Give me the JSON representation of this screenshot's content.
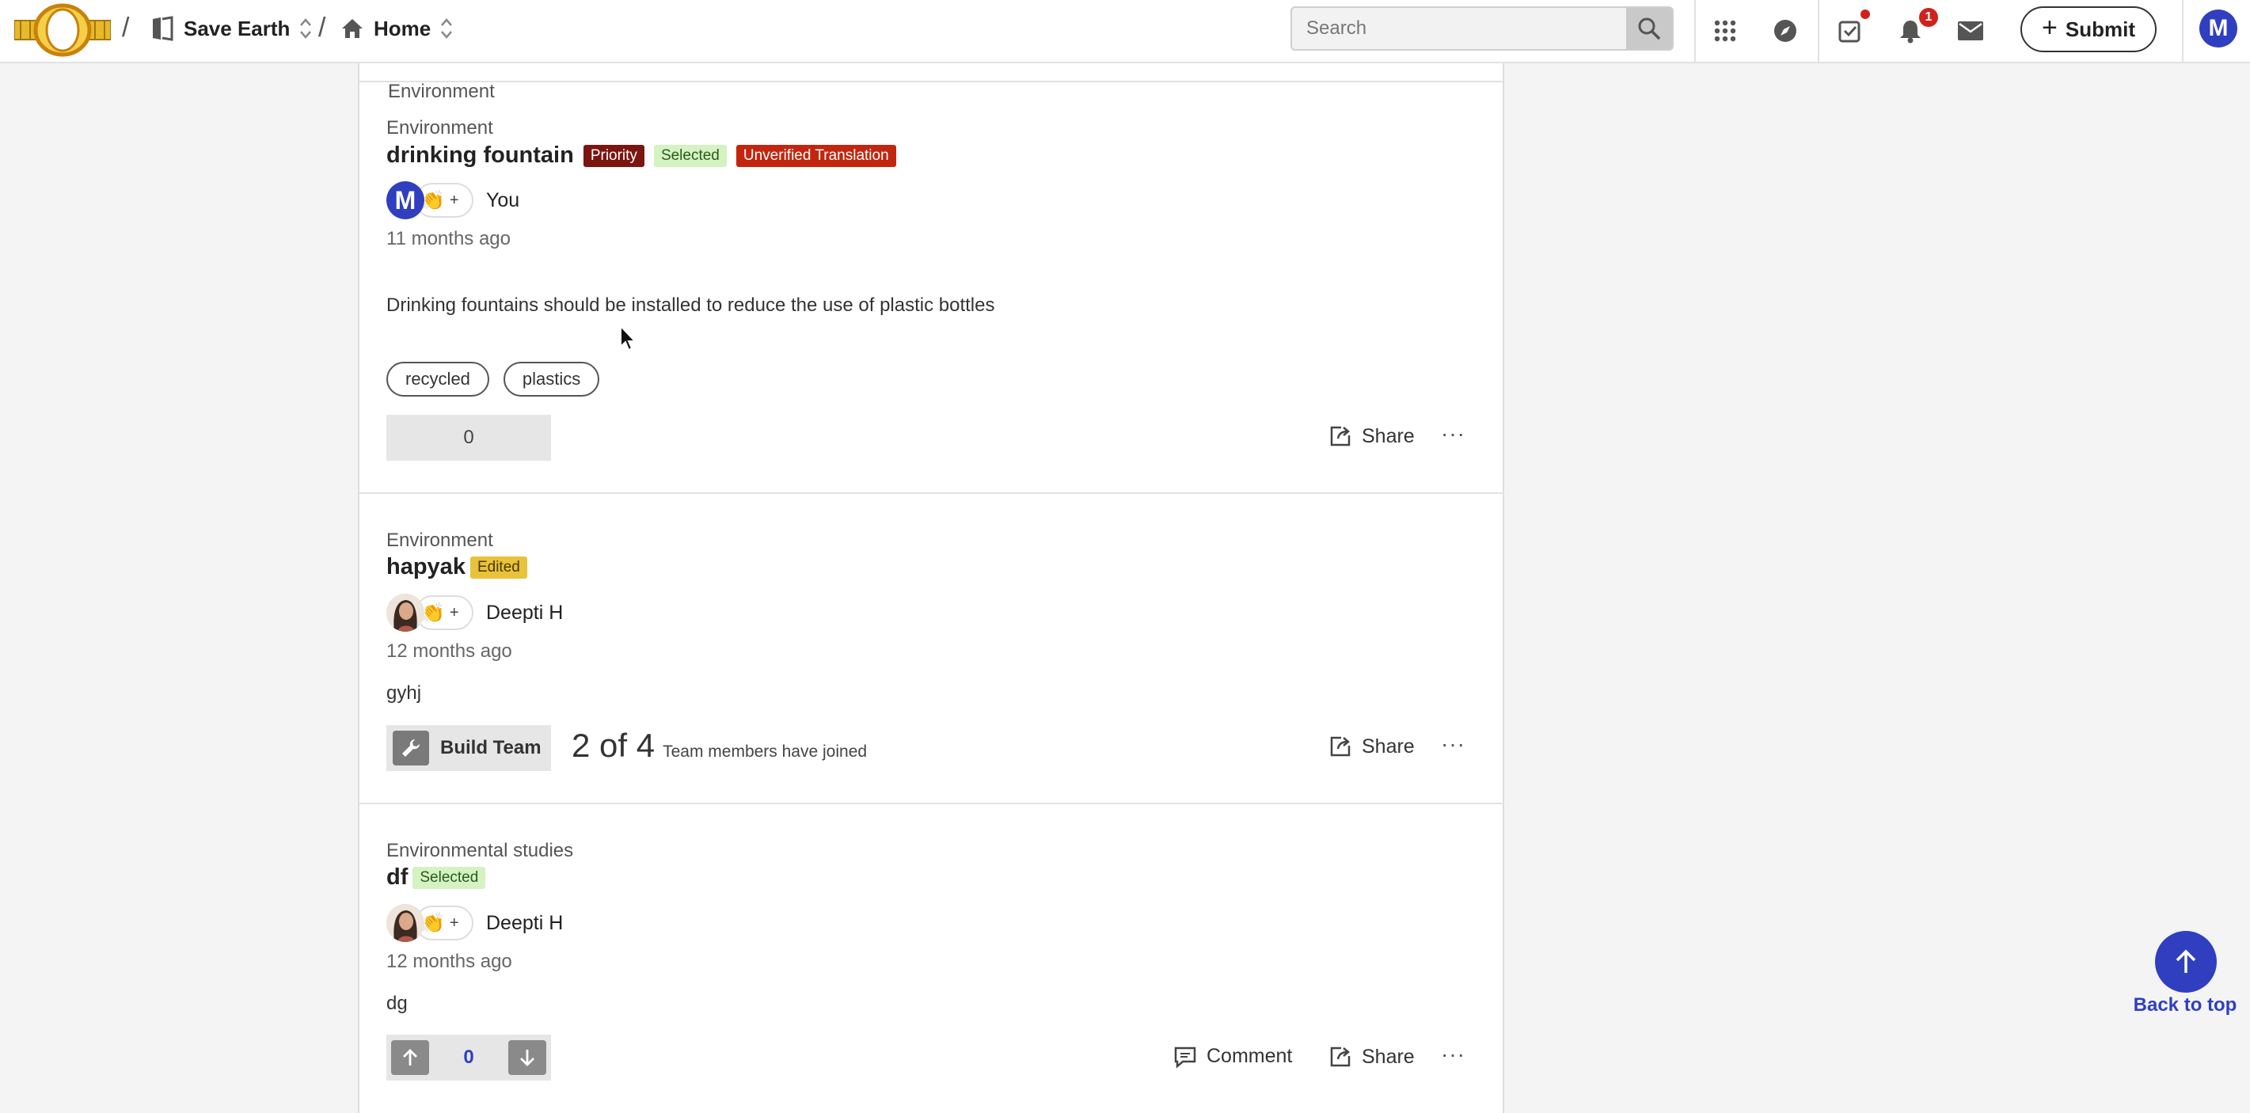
{
  "header": {
    "workspace": "Save Earth",
    "page": "Home",
    "search_placeholder": "Search",
    "notification_count": "1",
    "submit_label": "Submit",
    "user_initial": "M",
    "icons": [
      "apps-grid-icon",
      "compass-icon",
      "tasks-check-icon",
      "bell-icon",
      "mail-icon",
      "search-icon"
    ]
  },
  "posts": [
    {
      "category": "Environment",
      "title": "drinking fountain",
      "badges": [
        "Priority",
        "Selected",
        "Unverified Translation"
      ],
      "author_initial": "M",
      "author": "You",
      "time": "11 months ago",
      "body": "Drinking fountains should be installed to reduce the use of plastic bottles",
      "tags": [
        "recycled",
        "plastics"
      ],
      "votes": "0",
      "share": "Share",
      "more": "···"
    },
    {
      "category": "Environment",
      "title": "hapyak",
      "badges": [
        "Edited"
      ],
      "author": "Deepti H",
      "time": "12 months ago",
      "body": "gyhj",
      "build_team_label": "Build Team",
      "team_count": "2 of 4",
      "team_text": "Team members have joined",
      "share": "Share",
      "more": "···"
    },
    {
      "category": "Environmental studies",
      "title": "df",
      "badges": [
        "Selected"
      ],
      "author": "Deepti H",
      "time": "12 months ago",
      "body": "dg",
      "votes": "0",
      "comment": "Comment",
      "share": "Share",
      "more": "···"
    }
  ],
  "back_to_top": "Back to top",
  "reaction_emoji": "👏",
  "reaction_plus": "+",
  "colors": {
    "brand_blue": "#2f3fbf",
    "priority": "#7a1510",
    "selected_bg": "#d4f2c2",
    "unverified": "#c2260f",
    "edited": "#e8c23a"
  }
}
